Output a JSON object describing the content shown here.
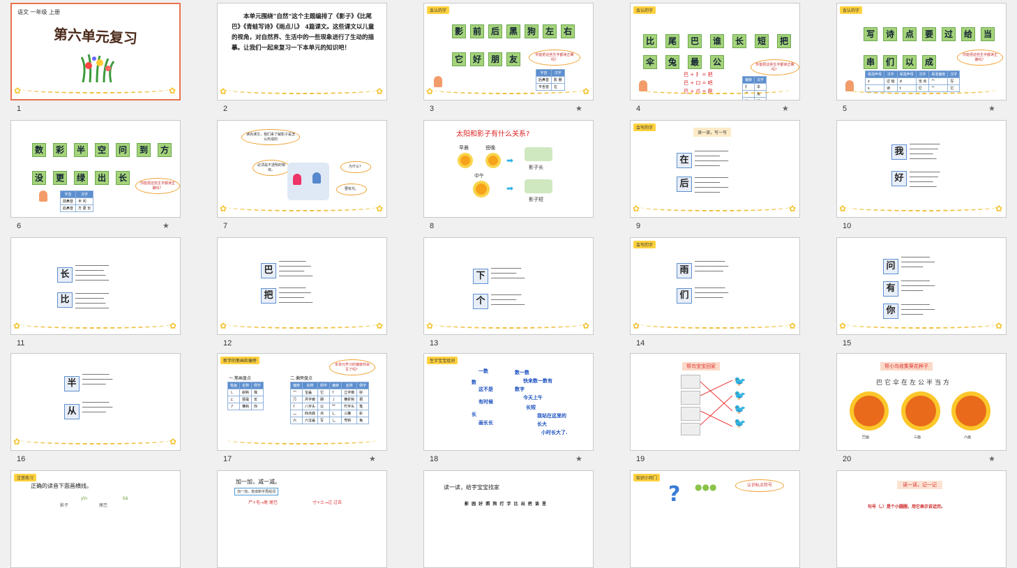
{
  "slides": [
    {
      "number": "1",
      "header": "语文  一年级  上册",
      "title": "第六单元复习"
    },
    {
      "number": "2",
      "text": "本单元围绕“自然”这个主题编排了《影子》《比尾巴》《青蛙写诗》《雨点儿》 4篇课文。这些课文以儿童的视角，对自然界、生活中的一些现象进行了生动的描摹。让我们一起来复习一下本单元的知识吧！"
    },
    {
      "number": "3",
      "tag": "会认的字",
      "row1": [
        "影",
        "前",
        "后",
        "黑",
        "狗",
        "左",
        "右"
      ],
      "row2": [
        "它",
        "好",
        "朋",
        "友"
      ],
      "bubble": "你能把这些生字都读正确吗？",
      "table_headers": [
        "字音",
        "汉字"
      ],
      "table_rows": [
        [
          "后鼻音",
          "影 朋"
        ],
        [
          "平舌音",
          "左"
        ]
      ]
    },
    {
      "number": "4",
      "tag": "会认的字",
      "row1": [
        "比",
        "尾",
        "巴",
        "谁",
        "长",
        "短",
        "把"
      ],
      "row2": [
        "伞",
        "兔",
        "最",
        "公"
      ],
      "formulas": [
        "巴 + 扌 = 把",
        "巴 + 口 = 吧",
        "巴 + 爪 = 爬"
      ],
      "bubble": "你能把这些生字都读正确吗？",
      "table_headers": [
        "偏旁",
        "汉字"
      ],
      "table_rows": [
        [
          "扌",
          "伞"
        ],
        [
          "⺈",
          "兔"
        ],
        [
          "八",
          "公"
        ]
      ]
    },
    {
      "number": "5",
      "tag": "会认的字",
      "row1": [
        "写",
        "诗",
        "点",
        "要",
        "过",
        "给",
        "当"
      ],
      "row2": [
        "串",
        "们",
        "以",
        "成"
      ],
      "bubble": "你能把这些生字都读正确吗？",
      "table_headers": [
        "易混声母",
        "汉字",
        "易混声母",
        "汉字",
        "易混偏旁",
        "汉字"
      ],
      "table_rows": [
        [
          "z",
          "过 给",
          "d",
          "当 点",
          "宀",
          "写"
        ],
        [
          "s",
          "诗",
          "t",
          "它",
          "亠",
          "它"
        ]
      ]
    },
    {
      "number": "6",
      "row1": [
        "数",
        "彩",
        "半",
        "空",
        "问",
        "到",
        "方"
      ],
      "row2": [
        "没",
        "更",
        "绿",
        "出",
        "长"
      ],
      "bubble": "你能把这些生字都读正确吗？",
      "table_headers": [
        "字音",
        "汉字"
      ],
      "table_rows": [
        [
          "前鼻音",
          "半 问"
        ],
        [
          "后鼻音",
          "方 更 长"
        ]
      ]
    },
    {
      "number": "7",
      "bubble_top": "读完课文，我们来了解影子是怎么形成的",
      "bubble_a": "必须是不透明的物体。",
      "bubble_b": "为什么？",
      "bubble_c": "要有光。"
    },
    {
      "number": "8",
      "title": "太阳和影子有什么关系?",
      "labels": [
        "早晨",
        "傍晚",
        "中午"
      ],
      "shadow_long": "影子长",
      "shadow_short": "影子短"
    },
    {
      "number": "9",
      "tag": "会写的字",
      "subtitle": "读一读，写一写",
      "chars": [
        "在",
        "后"
      ]
    },
    {
      "number": "10",
      "chars": [
        "我",
        "好"
      ]
    },
    {
      "number": "11",
      "chars": [
        "长",
        "比"
      ]
    },
    {
      "number": "12",
      "chars": [
        "巴",
        "把"
      ]
    },
    {
      "number": "13",
      "chars": [
        "下",
        "个"
      ]
    },
    {
      "number": "14",
      "tag": "会写的字",
      "chars": [
        "雨",
        "们"
      ]
    },
    {
      "number": "15",
      "chars": [
        "问",
        "有",
        "你"
      ]
    },
    {
      "number": "16",
      "chars": [
        "半",
        "从"
      ]
    },
    {
      "number": "17",
      "tag": "新学的笔画和偏旁",
      "section1": "一.笔画盘点",
      "section2": "二.偏旁盘点",
      "bubble": "本单元学习的偏旁你会写了吗？",
      "stroke_headers": [
        "笔画",
        "名称",
        "例字"
      ],
      "stroke_rows": [
        [
          "㇄",
          "斜钩",
          "我"
        ],
        [
          "ㄥ",
          "竖提",
          "长"
        ],
        [
          "㇇",
          "横钩",
          "你"
        ]
      ],
      "radical_headers": [
        "偏旁",
        "名称",
        "例字",
        "偏旁",
        "名称",
        "例字"
      ],
      "radical_rows": [
        [
          "宀",
          "宝盖",
          "它",
          "亻",
          "立字旁",
          "好"
        ],
        [
          "⺆",
          "月字旁",
          "朋",
          "丿",
          "横折钩",
          "把"
        ],
        [
          "亻",
          "八字头",
          "公",
          "⺮",
          "竹字头",
          "笔"
        ],
        [
          "灬",
          "四点底",
          "点",
          "⻌",
          "三撇",
          "彩"
        ],
        [
          "六",
          "六宝盖",
          "写",
          "乚",
          "弯钩",
          "兔"
        ]
      ]
    },
    {
      "number": "18",
      "tag": "生字宝宝组词",
      "phrases": [
        "一数",
        "数一数",
        "快来数一数有",
        "数",
        "数字",
        "这不是",
        "今天上午",
        "有时候",
        "长短",
        "长",
        "我站在这里的",
        "画长长",
        "长大",
        "小时长大了."
      ]
    },
    {
      "number": "19",
      "title": "帮鸟宝宝回家"
    },
    {
      "number": "20",
      "title": "帮小鸟收集葵花种子",
      "chars": "巴它伞在左公半当方",
      "labels": [
        "巴画",
        "三画",
        "六画"
      ]
    },
    {
      "number": "21",
      "tag": "注音练习",
      "text": "正确的读音下面画横线。",
      "pinyin": [
        "yǐn",
        "yǐng",
        "bā",
        "ba"
      ],
      "words": [
        "影子",
        "尾巴"
      ]
    },
    {
      "number": "22",
      "text": "加一加，减一减。",
      "sub": "加一加，变成新字再组词",
      "ops": [
        "尸+毛→尾 尾巴",
        "寸+土→过 过去"
      ]
    },
    {
      "number": "23",
      "text": "读一读，给字宝宝找家",
      "words": "影 园 好 照 狗 打 字 比 出 把 谈 里"
    },
    {
      "number": "24",
      "tag": "知识小窍门",
      "bubble": "认识标点符号"
    },
    {
      "number": "25",
      "title": "读一读，记一记",
      "text": "句号（。）是个小圆圈，用它表示说话完。"
    }
  ],
  "starred": [
    "3",
    "4",
    "5",
    "6",
    "17",
    "18",
    "20"
  ],
  "selected": "1",
  "colors": {
    "accent": "#e8734f",
    "tile": "#a5d37a",
    "wave": "#f0c040"
  }
}
